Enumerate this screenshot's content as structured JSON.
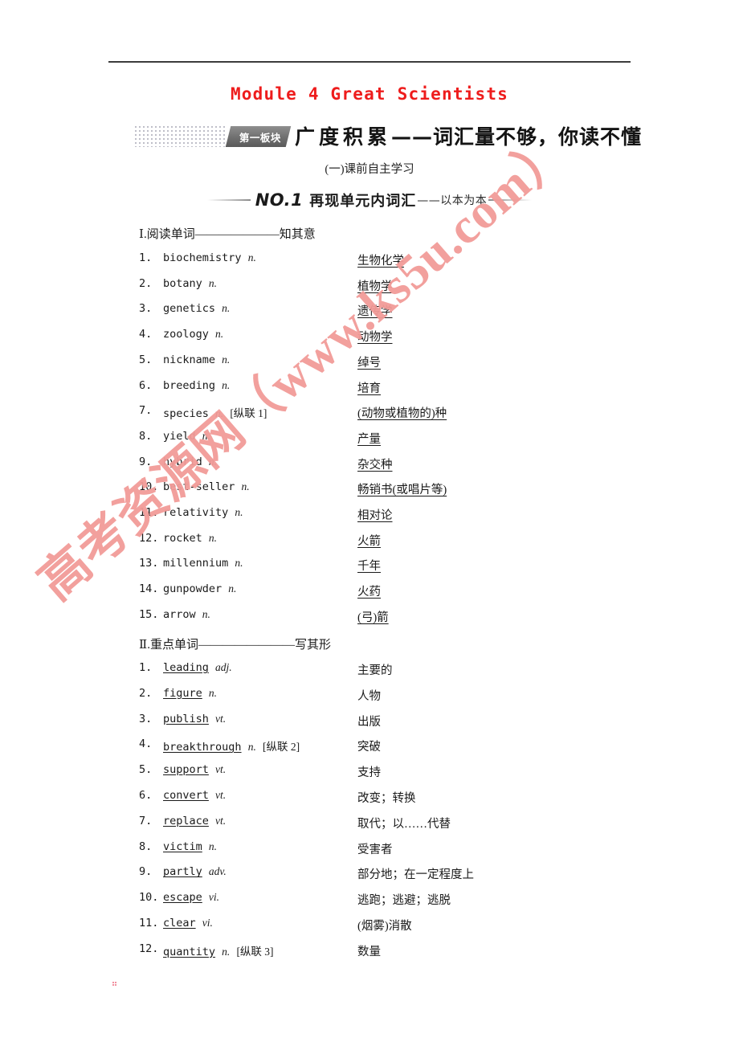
{
  "document": {
    "module_title": "Module 4 Great Scientists",
    "banner": {
      "tag": "第一板块",
      "head_main": "广度积累",
      "head_rest": "——词汇量不够，你读不懂"
    },
    "subtitle": "(一)课前自主学习",
    "no_heading": {
      "label": "NO.1",
      "main": "再现单元内词汇",
      "sub": "——以本为本"
    },
    "watermark": "高考资源网（www.ks5u.com）"
  },
  "section_one": {
    "heading_roman": "Ⅰ",
    "heading_text": ".阅读单词———————知其意",
    "items": [
      {
        "num": "1.",
        "word": "biochemistry",
        "pos": "n.",
        "note": "",
        "meaning": "生物化学"
      },
      {
        "num": "2.",
        "word": "botany",
        "pos": "n.",
        "note": "",
        "meaning": "植物学"
      },
      {
        "num": "3.",
        "word": "genetics",
        "pos": "n.",
        "note": "",
        "meaning": "遗传学"
      },
      {
        "num": "4.",
        "word": "zoology",
        "pos": "n.",
        "note": "",
        "meaning": "动物学"
      },
      {
        "num": "5.",
        "word": "nickname",
        "pos": "n.",
        "note": "",
        "meaning": "绰号"
      },
      {
        "num": "6.",
        "word": "breeding",
        "pos": "n.",
        "note": "",
        "meaning": "培育"
      },
      {
        "num": "7.",
        "word": "species",
        "pos": "n.",
        "note": "[纵联 1]",
        "meaning": "(动物或植物的)种"
      },
      {
        "num": "8.",
        "word": "yield",
        "pos": "n.",
        "note": "",
        "meaning": "产量"
      },
      {
        "num": "9.",
        "word": "hybrid",
        "pos": "n.",
        "note": "",
        "meaning": "杂交种"
      },
      {
        "num": "10.",
        "word": "best-seller",
        "pos": "n.",
        "note": "",
        "meaning": "畅销书(或唱片等)"
      },
      {
        "num": "11.",
        "word": "relativity",
        "pos": "n.",
        "note": "",
        "meaning": "相对论"
      },
      {
        "num": "12.",
        "word": "rocket",
        "pos": "n.",
        "note": "",
        "meaning": "火箭"
      },
      {
        "num": "13.",
        "word": "millennium",
        "pos": "n.",
        "note": "",
        "meaning": "千年"
      },
      {
        "num": "14.",
        "word": "gunpowder",
        "pos": "n.",
        "note": "",
        "meaning": "火药 "
      },
      {
        "num": "15.",
        "word": "arrow",
        "pos": "n.",
        "note": "",
        "meaning": "(弓)箭"
      }
    ]
  },
  "section_two": {
    "heading_roman": "Ⅱ",
    "heading_text": ".重点单词————————写其形",
    "items": [
      {
        "num": "1.",
        "word": "leading",
        "pos": "adj.",
        "note": "",
        "meaning": "主要的"
      },
      {
        "num": "2.",
        "word": "figure",
        "pos": "n.",
        "note": "",
        "meaning": "人物"
      },
      {
        "num": "3.",
        "word": "publish",
        "pos": "vt.",
        "note": "",
        "meaning": "出版"
      },
      {
        "num": "4.",
        "word": "breakthrough",
        "pos": "n.",
        "note": "[纵联 2]",
        "meaning": "突破"
      },
      {
        "num": "5.",
        "word": "support",
        "pos": "vt.",
        "note": "",
        "meaning": "支持"
      },
      {
        "num": "6.",
        "word": "convert",
        "pos": "vt.",
        "note": "",
        "meaning": "改变；转换"
      },
      {
        "num": "7.",
        "word": "replace",
        "pos": "vt.",
        "note": "",
        "meaning": "取代；以……代替"
      },
      {
        "num": "8.",
        "word": "victim",
        "pos": "n.",
        "note": "",
        "meaning": "受害者"
      },
      {
        "num": "9.",
        "word": "partly",
        "pos": "adv.",
        "note": "",
        "meaning": "部分地；在一定程度上"
      },
      {
        "num": "10.",
        "word": "escape",
        "pos": "vi.",
        "note": "",
        "meaning": "逃跑；逃避；逃脱"
      },
      {
        "num": "11.",
        "word": "clear",
        "pos": "vi.",
        "note": "",
        "meaning": "(烟雾)消散"
      },
      {
        "num": "12.",
        "word": "quantity",
        "pos": "n.",
        "note": "[纵联 3]",
        "meaning": "数量"
      }
    ]
  },
  "colors": {
    "title_red": "#ee1c1c",
    "watermark_pink": "#f29b98",
    "banner_gray": "#6f6f6f",
    "text_black": "#1a1a1a"
  }
}
